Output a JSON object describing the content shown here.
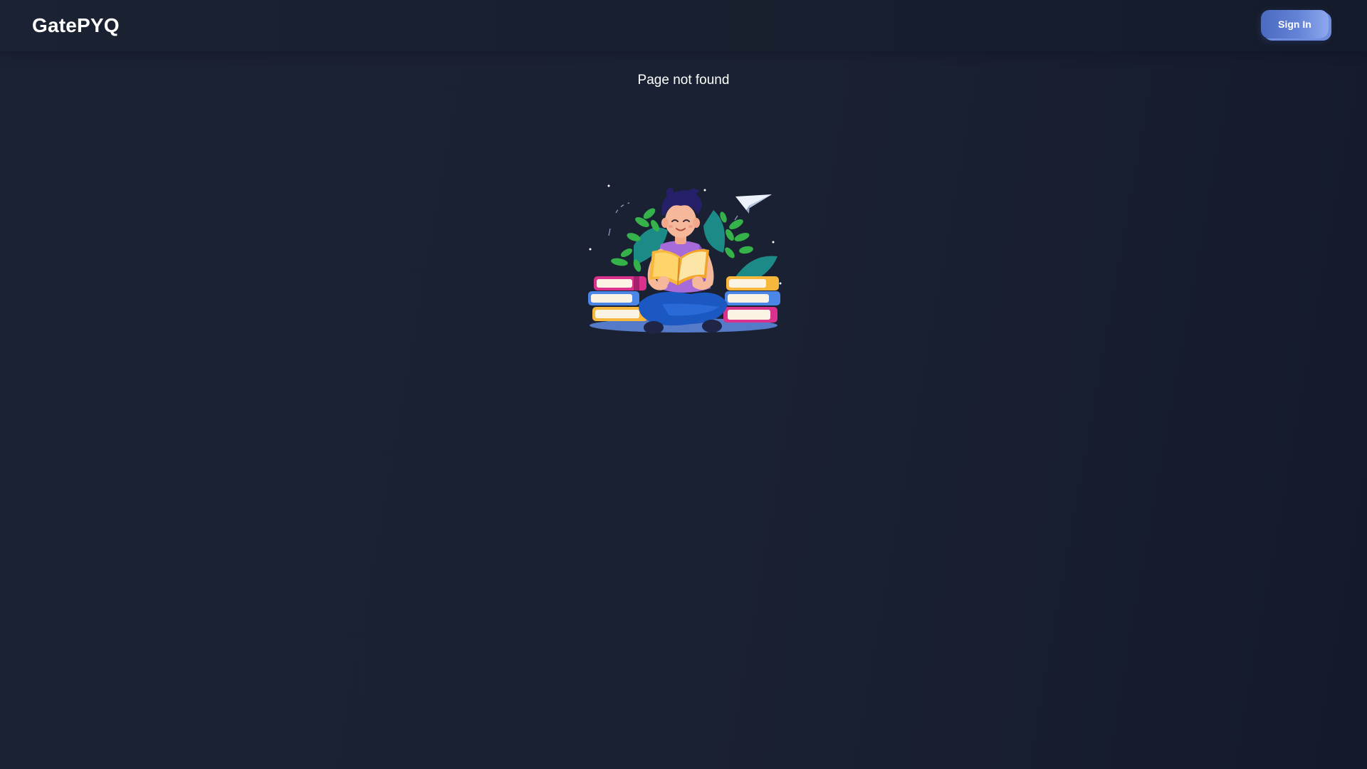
{
  "header": {
    "brand": "GatePYQ",
    "signin_label": "Sign In"
  },
  "main": {
    "message": "Page not found",
    "illustration_icon": "reading-student-illustration"
  },
  "colors": {
    "background": "#1a2132",
    "button_accent": "#5a7ad0",
    "text": "#ffffff"
  }
}
